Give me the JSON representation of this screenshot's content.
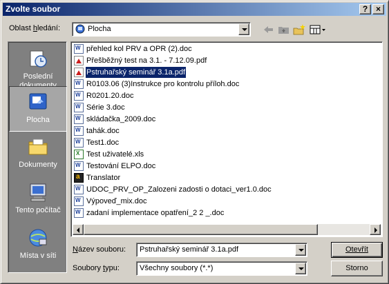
{
  "dialog": {
    "title": "Zvolte soubor",
    "help_glyph": "?",
    "close_glyph": "×"
  },
  "look_in": {
    "label_pre": "Oblast ",
    "label_u": "h",
    "label_post": "ledání:",
    "value": "Plocha",
    "icon": "desktop-icon"
  },
  "toolbar": {
    "icons": [
      "back-arrow-icon",
      "up-folder-icon",
      "new-folder-icon",
      "view-menu-icon"
    ]
  },
  "places": [
    {
      "label": "Poslední dokumenty",
      "icon": "recent-documents-icon",
      "selected": false
    },
    {
      "label": "Plocha",
      "icon": "desktop-icon",
      "selected": true
    },
    {
      "label": "Dokumenty",
      "icon": "documents-folder-icon",
      "selected": false
    },
    {
      "label": "Tento počítač",
      "icon": "my-computer-icon",
      "selected": false
    },
    {
      "label": "Místa v síti",
      "icon": "network-places-icon",
      "selected": false
    }
  ],
  "files": [
    {
      "name": "přehled kol PRV a OPR (2).doc",
      "type": "doc",
      "selected": false
    },
    {
      "name": "Přešběžný test na 3.1. - 7.12.09.pdf",
      "type": "pdf",
      "selected": false
    },
    {
      "name": "Pstruhařský seminář 3.1a.pdf",
      "type": "pdf",
      "selected": true
    },
    {
      "name": "R0103.06 (3)Instrukce pro kontrolu příloh.doc",
      "type": "doc",
      "selected": false
    },
    {
      "name": "R0201.20.doc",
      "type": "doc",
      "selected": false
    },
    {
      "name": "Série 3.doc",
      "type": "doc",
      "selected": false
    },
    {
      "name": "skládačka_2009.doc",
      "type": "doc",
      "selected": false
    },
    {
      "name": "tahák.doc",
      "type": "doc",
      "selected": false
    },
    {
      "name": "Test1.doc",
      "type": "doc",
      "selected": false
    },
    {
      "name": "Test uživatelé.xls",
      "type": "xls",
      "selected": false
    },
    {
      "name": "Testování ELPO.doc",
      "type": "doc",
      "selected": false
    },
    {
      "name": "Translator",
      "type": "app",
      "selected": false
    },
    {
      "name": "UDOC_PRV_OP_Zalozeni zadosti o dotaci_ver1.0.doc",
      "type": "doc",
      "selected": false
    },
    {
      "name": "Výpoveď_mix.doc",
      "type": "doc",
      "selected": false
    },
    {
      "name": "zadaní implementace opatření_2 2 _.doc",
      "type": "doc",
      "selected": false
    }
  ],
  "filename": {
    "label_pre": "",
    "label_u": "N",
    "label_post": "ázev souboru:",
    "value": "Pstruhařský seminář 3.1a.pdf"
  },
  "filetype": {
    "label_pre": "Soubory ",
    "label_u": "t",
    "label_post": "ypu:",
    "value": "Všechny soubory (*.*)"
  },
  "buttons": {
    "open": "Otevřít",
    "cancel": "Storno"
  },
  "colors": {
    "title_start": "#0a246a",
    "title_end": "#a6caf0",
    "selection": "#0a246a",
    "face": "#d4d0c8",
    "places_bg": "#808080"
  }
}
